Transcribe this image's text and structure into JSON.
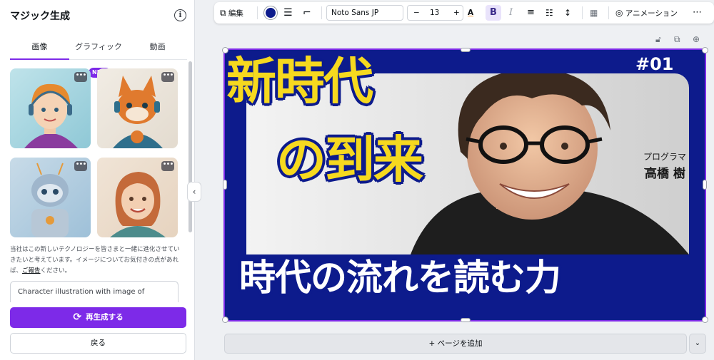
{
  "panel": {
    "title": "マジック生成",
    "tabs": [
      {
        "label": "画像"
      },
      {
        "label": "グラフィック",
        "badge": "NEW"
      },
      {
        "label": "動画"
      }
    ],
    "description_before_link": "当社はこの新しいテクノロジーを皆さまと一緒に進化させていきたいと考えています。イメージについてお気付きの点があれば、",
    "report_link": "ご報告",
    "description_after_link": "ください。",
    "prompt_value": "Character illustration with image of",
    "regenerate_label": "再生成する",
    "back_label": "戻る"
  },
  "toolbar": {
    "edit_label": "編集",
    "font_name": "Noto Sans JP",
    "font_size": "13",
    "bold_label": "B",
    "italic_label": "I",
    "animation_label": "アニメーション",
    "text_color": "#0d1b8c"
  },
  "design": {
    "episode": "#01",
    "headline_line1": "新時代",
    "headline_line2": "の到来",
    "role": "プログラマー",
    "name": "高橋 樹",
    "subline": "時代の流れを読む力",
    "accent_color": "#f6d91f",
    "background_color": "#0d1b8c"
  },
  "footer": {
    "add_page_label": "+ ページを追加"
  }
}
